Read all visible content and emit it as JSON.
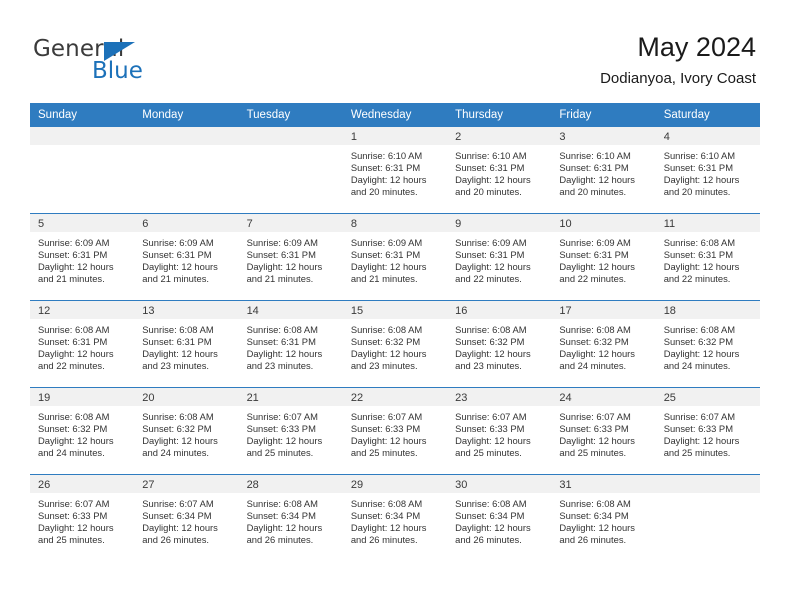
{
  "brand": {
    "name_top": "General",
    "name_bottom": "Blue",
    "triangle_icon": "blue-triangle-icon",
    "color_dark": "#3b3b3b",
    "color_blue": "#1c71b9"
  },
  "header": {
    "title": "May 2024",
    "subtitle": "Dodianyoa, Ivory Coast"
  },
  "theme": {
    "header_blue": "#2f7cc0",
    "daynum_band": "#f1f1f1",
    "text": "#333333"
  },
  "weekday_headers": [
    "Sunday",
    "Monday",
    "Tuesday",
    "Wednesday",
    "Thursday",
    "Friday",
    "Saturday"
  ],
  "weeks": [
    [
      {
        "day": "",
        "lines": []
      },
      {
        "day": "",
        "lines": []
      },
      {
        "day": "",
        "lines": []
      },
      {
        "day": "1",
        "lines": [
          "Sunrise: 6:10 AM",
          "Sunset: 6:31 PM",
          "Daylight: 12 hours",
          "and 20 minutes."
        ]
      },
      {
        "day": "2",
        "lines": [
          "Sunrise: 6:10 AM",
          "Sunset: 6:31 PM",
          "Daylight: 12 hours",
          "and 20 minutes."
        ]
      },
      {
        "day": "3",
        "lines": [
          "Sunrise: 6:10 AM",
          "Sunset: 6:31 PM",
          "Daylight: 12 hours",
          "and 20 minutes."
        ]
      },
      {
        "day": "4",
        "lines": [
          "Sunrise: 6:10 AM",
          "Sunset: 6:31 PM",
          "Daylight: 12 hours",
          "and 20 minutes."
        ]
      }
    ],
    [
      {
        "day": "5",
        "lines": [
          "Sunrise: 6:09 AM",
          "Sunset: 6:31 PM",
          "Daylight: 12 hours",
          "and 21 minutes."
        ]
      },
      {
        "day": "6",
        "lines": [
          "Sunrise: 6:09 AM",
          "Sunset: 6:31 PM",
          "Daylight: 12 hours",
          "and 21 minutes."
        ]
      },
      {
        "day": "7",
        "lines": [
          "Sunrise: 6:09 AM",
          "Sunset: 6:31 PM",
          "Daylight: 12 hours",
          "and 21 minutes."
        ]
      },
      {
        "day": "8",
        "lines": [
          "Sunrise: 6:09 AM",
          "Sunset: 6:31 PM",
          "Daylight: 12 hours",
          "and 21 minutes."
        ]
      },
      {
        "day": "9",
        "lines": [
          "Sunrise: 6:09 AM",
          "Sunset: 6:31 PM",
          "Daylight: 12 hours",
          "and 22 minutes."
        ]
      },
      {
        "day": "10",
        "lines": [
          "Sunrise: 6:09 AM",
          "Sunset: 6:31 PM",
          "Daylight: 12 hours",
          "and 22 minutes."
        ]
      },
      {
        "day": "11",
        "lines": [
          "Sunrise: 6:08 AM",
          "Sunset: 6:31 PM",
          "Daylight: 12 hours",
          "and 22 minutes."
        ]
      }
    ],
    [
      {
        "day": "12",
        "lines": [
          "Sunrise: 6:08 AM",
          "Sunset: 6:31 PM",
          "Daylight: 12 hours",
          "and 22 minutes."
        ]
      },
      {
        "day": "13",
        "lines": [
          "Sunrise: 6:08 AM",
          "Sunset: 6:31 PM",
          "Daylight: 12 hours",
          "and 23 minutes."
        ]
      },
      {
        "day": "14",
        "lines": [
          "Sunrise: 6:08 AM",
          "Sunset: 6:31 PM",
          "Daylight: 12 hours",
          "and 23 minutes."
        ]
      },
      {
        "day": "15",
        "lines": [
          "Sunrise: 6:08 AM",
          "Sunset: 6:32 PM",
          "Daylight: 12 hours",
          "and 23 minutes."
        ]
      },
      {
        "day": "16",
        "lines": [
          "Sunrise: 6:08 AM",
          "Sunset: 6:32 PM",
          "Daylight: 12 hours",
          "and 23 minutes."
        ]
      },
      {
        "day": "17",
        "lines": [
          "Sunrise: 6:08 AM",
          "Sunset: 6:32 PM",
          "Daylight: 12 hours",
          "and 24 minutes."
        ]
      },
      {
        "day": "18",
        "lines": [
          "Sunrise: 6:08 AM",
          "Sunset: 6:32 PM",
          "Daylight: 12 hours",
          "and 24 minutes."
        ]
      }
    ],
    [
      {
        "day": "19",
        "lines": [
          "Sunrise: 6:08 AM",
          "Sunset: 6:32 PM",
          "Daylight: 12 hours",
          "and 24 minutes."
        ]
      },
      {
        "day": "20",
        "lines": [
          "Sunrise: 6:08 AM",
          "Sunset: 6:32 PM",
          "Daylight: 12 hours",
          "and 24 minutes."
        ]
      },
      {
        "day": "21",
        "lines": [
          "Sunrise: 6:07 AM",
          "Sunset: 6:33 PM",
          "Daylight: 12 hours",
          "and 25 minutes."
        ]
      },
      {
        "day": "22",
        "lines": [
          "Sunrise: 6:07 AM",
          "Sunset: 6:33 PM",
          "Daylight: 12 hours",
          "and 25 minutes."
        ]
      },
      {
        "day": "23",
        "lines": [
          "Sunrise: 6:07 AM",
          "Sunset: 6:33 PM",
          "Daylight: 12 hours",
          "and 25 minutes."
        ]
      },
      {
        "day": "24",
        "lines": [
          "Sunrise: 6:07 AM",
          "Sunset: 6:33 PM",
          "Daylight: 12 hours",
          "and 25 minutes."
        ]
      },
      {
        "day": "25",
        "lines": [
          "Sunrise: 6:07 AM",
          "Sunset: 6:33 PM",
          "Daylight: 12 hours",
          "and 25 minutes."
        ]
      }
    ],
    [
      {
        "day": "26",
        "lines": [
          "Sunrise: 6:07 AM",
          "Sunset: 6:33 PM",
          "Daylight: 12 hours",
          "and 25 minutes."
        ]
      },
      {
        "day": "27",
        "lines": [
          "Sunrise: 6:07 AM",
          "Sunset: 6:34 PM",
          "Daylight: 12 hours",
          "and 26 minutes."
        ]
      },
      {
        "day": "28",
        "lines": [
          "Sunrise: 6:08 AM",
          "Sunset: 6:34 PM",
          "Daylight: 12 hours",
          "and 26 minutes."
        ]
      },
      {
        "day": "29",
        "lines": [
          "Sunrise: 6:08 AM",
          "Sunset: 6:34 PM",
          "Daylight: 12 hours",
          "and 26 minutes."
        ]
      },
      {
        "day": "30",
        "lines": [
          "Sunrise: 6:08 AM",
          "Sunset: 6:34 PM",
          "Daylight: 12 hours",
          "and 26 minutes."
        ]
      },
      {
        "day": "31",
        "lines": [
          "Sunrise: 6:08 AM",
          "Sunset: 6:34 PM",
          "Daylight: 12 hours",
          "and 26 minutes."
        ]
      },
      {
        "day": "",
        "lines": []
      }
    ]
  ]
}
